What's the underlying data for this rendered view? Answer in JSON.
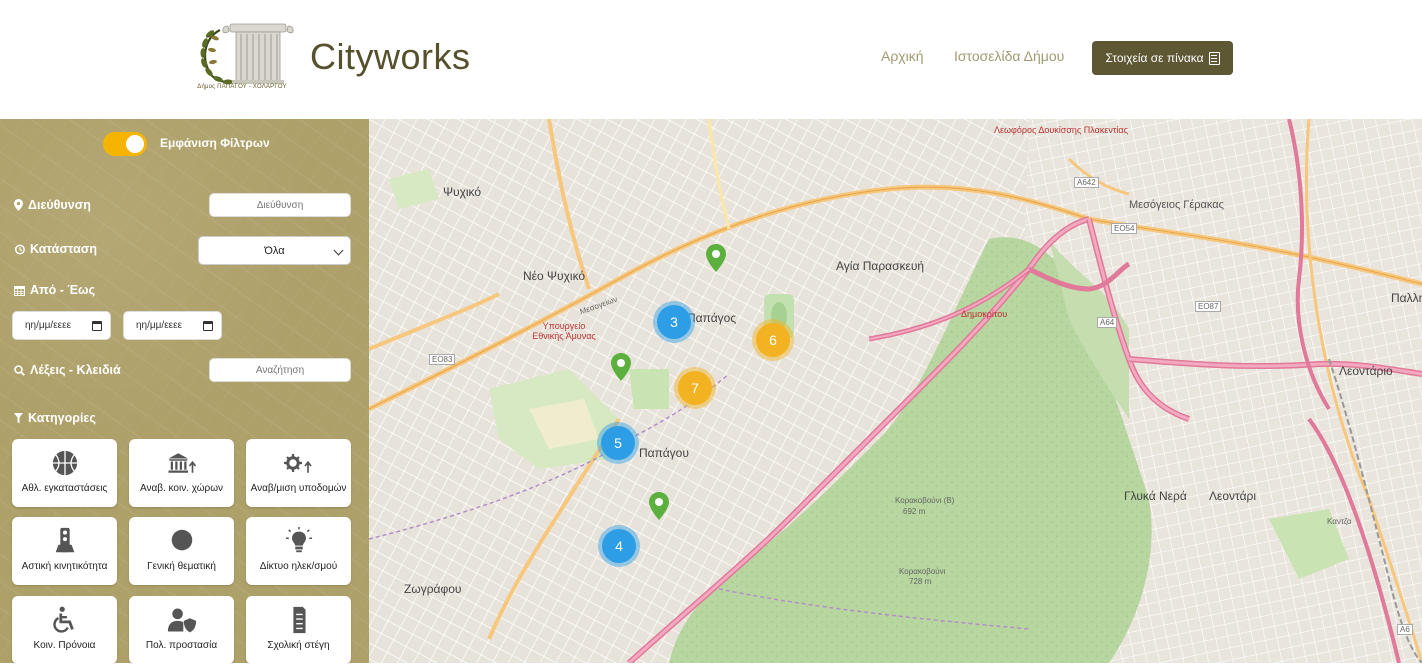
{
  "header": {
    "brand": "Cityworks",
    "logo_caption": "Δήμος ΠΑΠΑΓΟΥ - ΧΟΛΑΡΓΟΥ",
    "nav": {
      "home": "Αρχική",
      "municipality_site": "Ιστοσελίδα Δήμου"
    },
    "table_button": "Στοιχεία σε πίνακα"
  },
  "sidebar": {
    "toggle_label": "Εμφάνιση Φίλτρων",
    "toggle_on": true,
    "address": {
      "label": "Διεύθυνση",
      "placeholder": "Διεύθυνση"
    },
    "status": {
      "label": "Κατάσταση",
      "selected": "Όλα"
    },
    "dates": {
      "label": "Από - Έως",
      "from": "ηη/μμ/εεεε",
      "to": "ηη/μμ/εεεε"
    },
    "keywords": {
      "label": "Λέξεις - Κλειδιά",
      "placeholder": "Αναζήτηση"
    },
    "categories": {
      "label": "Κατηγορίες",
      "items": [
        {
          "label": "Αθλ. εγκαταστάσεις",
          "icon": "basketball-icon"
        },
        {
          "label": "Αναβ. κοιν. χώρων",
          "icon": "building-up-icon"
        },
        {
          "label": "Αναβ/μιση υποδομών",
          "icon": "gears-up-icon"
        },
        {
          "label": "Αστική κινητικότητα",
          "icon": "traffic-light-icon"
        },
        {
          "label": "Γενική θεματική",
          "icon": "circle-icon"
        },
        {
          "label": "Δίκτυο ηλεκ/σμού",
          "icon": "lightbulb-icon"
        },
        {
          "label": "Κοιν. Πρόνοια",
          "icon": "wheelchair-icon"
        },
        {
          "label": "Πολ. προστασία",
          "icon": "user-shield-icon"
        },
        {
          "label": "Σχολική στέγη",
          "icon": "school-building-icon"
        }
      ]
    }
  },
  "map": {
    "clusters": [
      {
        "count": "3",
        "color": "blue"
      },
      {
        "count": "6",
        "color": "yellow"
      },
      {
        "count": "7",
        "color": "yellow"
      },
      {
        "count": "5",
        "color": "blue"
      },
      {
        "count": "4",
        "color": "blue"
      }
    ],
    "labels": {
      "psychiko": "Ψυχικό",
      "neo_psychiko": "Νέο Ψυχικό",
      "agia_paraskevi": "Αγία Παρασκευή",
      "papagou": "Παπάγος",
      "papagou2": "Παπάγου",
      "zografou": "Ζωγράφου",
      "glyka_nera": "Γλυκά Νερά",
      "leontari": "Λεοντάρι",
      "leontario": "Λεοντάριο",
      "pallini": "Παλλη",
      "gerakas": "Μεσόγειος Γέρακας",
      "ministry": "Υπουργείο Εθνικής Άμυνας",
      "korakobouni_b": "Κορακοβούνι (Β)",
      "korakobouni_b_height": "692 m",
      "korakobouni": "Κορακοβούνι",
      "korakobouni_height": "728 m",
      "a642": "A642",
      "e054": "ΕΟ54",
      "e087": "ΕΟ87",
      "a64": "A64",
      "e083": "ΕΟ83",
      "a6": "A6",
      "dimokritou": "Δημοκρίτου",
      "mesogeion": "Μεσογείων",
      "kantza": "Καντζα",
      "kifisias": "Λεωφόρος Δουκίσσης Πλακεντίας"
    }
  },
  "colors": {
    "brand": "#55512c",
    "button": "#5d5733",
    "sidebar": "#aea069",
    "toggle": "#f5b400",
    "cluster_blue": "#2d9ee6",
    "cluster_yellow": "#f2b221",
    "pin": "#5cb13e"
  }
}
